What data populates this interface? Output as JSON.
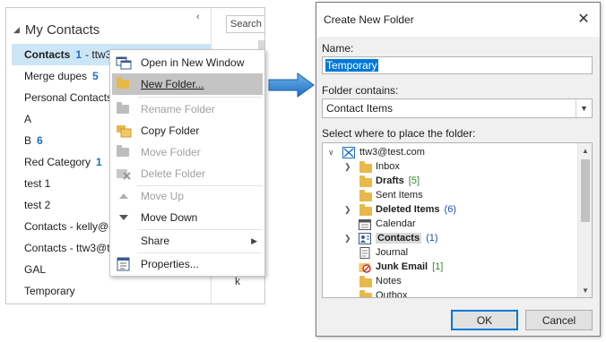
{
  "outlook": {
    "group_header": "My Contacts",
    "search_placeholder": "Search",
    "strip_letter": "k",
    "folders": [
      {
        "label": "Contacts",
        "count": "1",
        "suffix": "- ttw3",
        "selected": true
      },
      {
        "label": "Merge dupes",
        "count": "5"
      },
      {
        "label": "Personal Contacts",
        "count": ""
      },
      {
        "label": "A",
        "count": ""
      },
      {
        "label": "B",
        "count": "6"
      },
      {
        "label": "Red Category",
        "count": "1"
      },
      {
        "label": "test 1",
        "count": ""
      },
      {
        "label": "test 2",
        "count": ""
      },
      {
        "label": "Contacts - kelly@e",
        "count": ""
      },
      {
        "label": "Contacts - ttw3@t",
        "count": ""
      },
      {
        "label": "GAL",
        "count": ""
      },
      {
        "label": "Temporary",
        "count": ""
      }
    ]
  },
  "context_menu": {
    "items": [
      {
        "label": "Open in New Window",
        "icon": "open-window-icon",
        "enabled": true
      },
      {
        "label": "New Folder...",
        "icon": "new-folder-icon",
        "enabled": true,
        "highlighted": true
      },
      {
        "label": "Rename Folder",
        "icon": "rename-folder-icon",
        "enabled": false
      },
      {
        "label": "Copy Folder",
        "icon": "copy-folder-icon",
        "enabled": true
      },
      {
        "label": "Move Folder",
        "icon": "move-folder-icon",
        "enabled": false
      },
      {
        "label": "Delete Folder",
        "icon": "delete-folder-icon",
        "enabled": false
      },
      {
        "label": "Move Up",
        "icon": "move-up-icon",
        "enabled": false
      },
      {
        "label": "Move Down",
        "icon": "move-down-icon",
        "enabled": true
      },
      {
        "label": "Share",
        "icon": "",
        "enabled": true,
        "submenu": true
      },
      {
        "label": "Properties...",
        "icon": "properties-icon",
        "enabled": true
      }
    ]
  },
  "dialog": {
    "title": "Create New Folder",
    "name_label": "Name:",
    "name_value": "Temporary",
    "contains_label": "Folder contains:",
    "contains_value": "Contact Items",
    "tree_label": "Select where to place the folder:",
    "tree": [
      {
        "label": "ttw3@test.com",
        "count": "",
        "icon": "mailbox-icon",
        "expand": "open"
      },
      {
        "label": "Inbox",
        "count": "",
        "icon": "inbox-icon",
        "expand": "closed"
      },
      {
        "label": "Drafts",
        "count": "[5]",
        "icon": "drafts-icon",
        "expand": "",
        "bold": true,
        "count_color": "green"
      },
      {
        "label": "Sent Items",
        "count": "",
        "icon": "sent-icon",
        "expand": ""
      },
      {
        "label": "Deleted Items",
        "count": "(6)",
        "icon": "deleted-icon",
        "expand": "closed",
        "bold": true,
        "count_color": "blue"
      },
      {
        "label": "Calendar",
        "count": "",
        "icon": "calendar-icon",
        "expand": ""
      },
      {
        "label": "Contacts",
        "count": "(1)",
        "icon": "contacts-icon",
        "expand": "closed",
        "bold": true,
        "selected": true,
        "count_color": "blue"
      },
      {
        "label": "Journal",
        "count": "",
        "icon": "journal-icon",
        "expand": ""
      },
      {
        "label": "Junk Email",
        "count": "[1]",
        "icon": "junk-icon",
        "expand": "",
        "bold": true,
        "count_color": "green"
      },
      {
        "label": "Notes",
        "count": "",
        "icon": "notes-icon",
        "expand": ""
      },
      {
        "label": "Outbox",
        "count": "",
        "icon": "outbox-icon",
        "expand": ""
      }
    ],
    "ok_label": "OK",
    "cancel_label": "Cancel"
  },
  "colors": {
    "accent": "#0078d7",
    "selected_row": "#cde6f7",
    "count_blue": "#1c6fba",
    "count_green": "#2e8b2e",
    "arrow_blue": "#2a7fd4"
  }
}
